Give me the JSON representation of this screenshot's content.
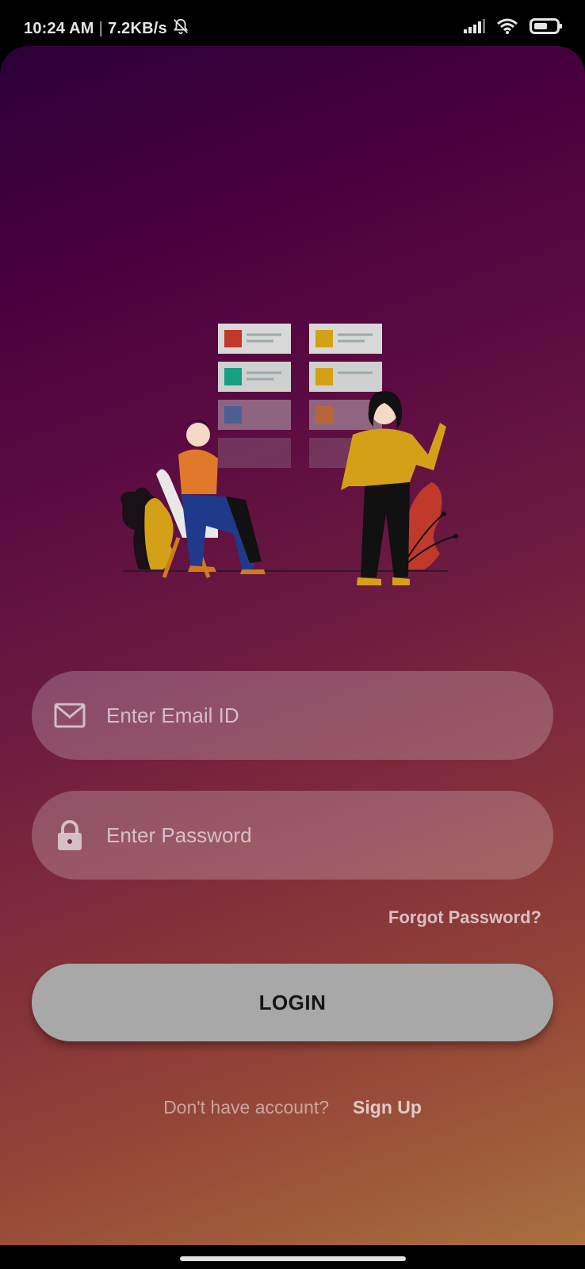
{
  "status_bar": {
    "time": "10:24 AM",
    "separator": "|",
    "network_speed": "7.2KB/s",
    "icons": [
      "bell-off-icon",
      "signal-icon",
      "wifi-icon",
      "battery-icon"
    ]
  },
  "illustration": {
    "name": "two-people-with-cards-illustration"
  },
  "login_form": {
    "email": {
      "placeholder": "Enter Email ID",
      "icon": "mail-icon"
    },
    "password": {
      "placeholder": "Enter Password",
      "icon": "lock-icon"
    },
    "forgot_password_label": "Forgot Password?",
    "login_label": "LOGIN"
  },
  "signup": {
    "prompt": "Don't have account?",
    "link_label": "Sign Up"
  },
  "colors": {
    "gradient_top": "#2d0038",
    "gradient_bottom": "#a8703f",
    "button_bg": "#a8a8a8",
    "field_bg": "rgba(255,255,255,0.22)"
  }
}
